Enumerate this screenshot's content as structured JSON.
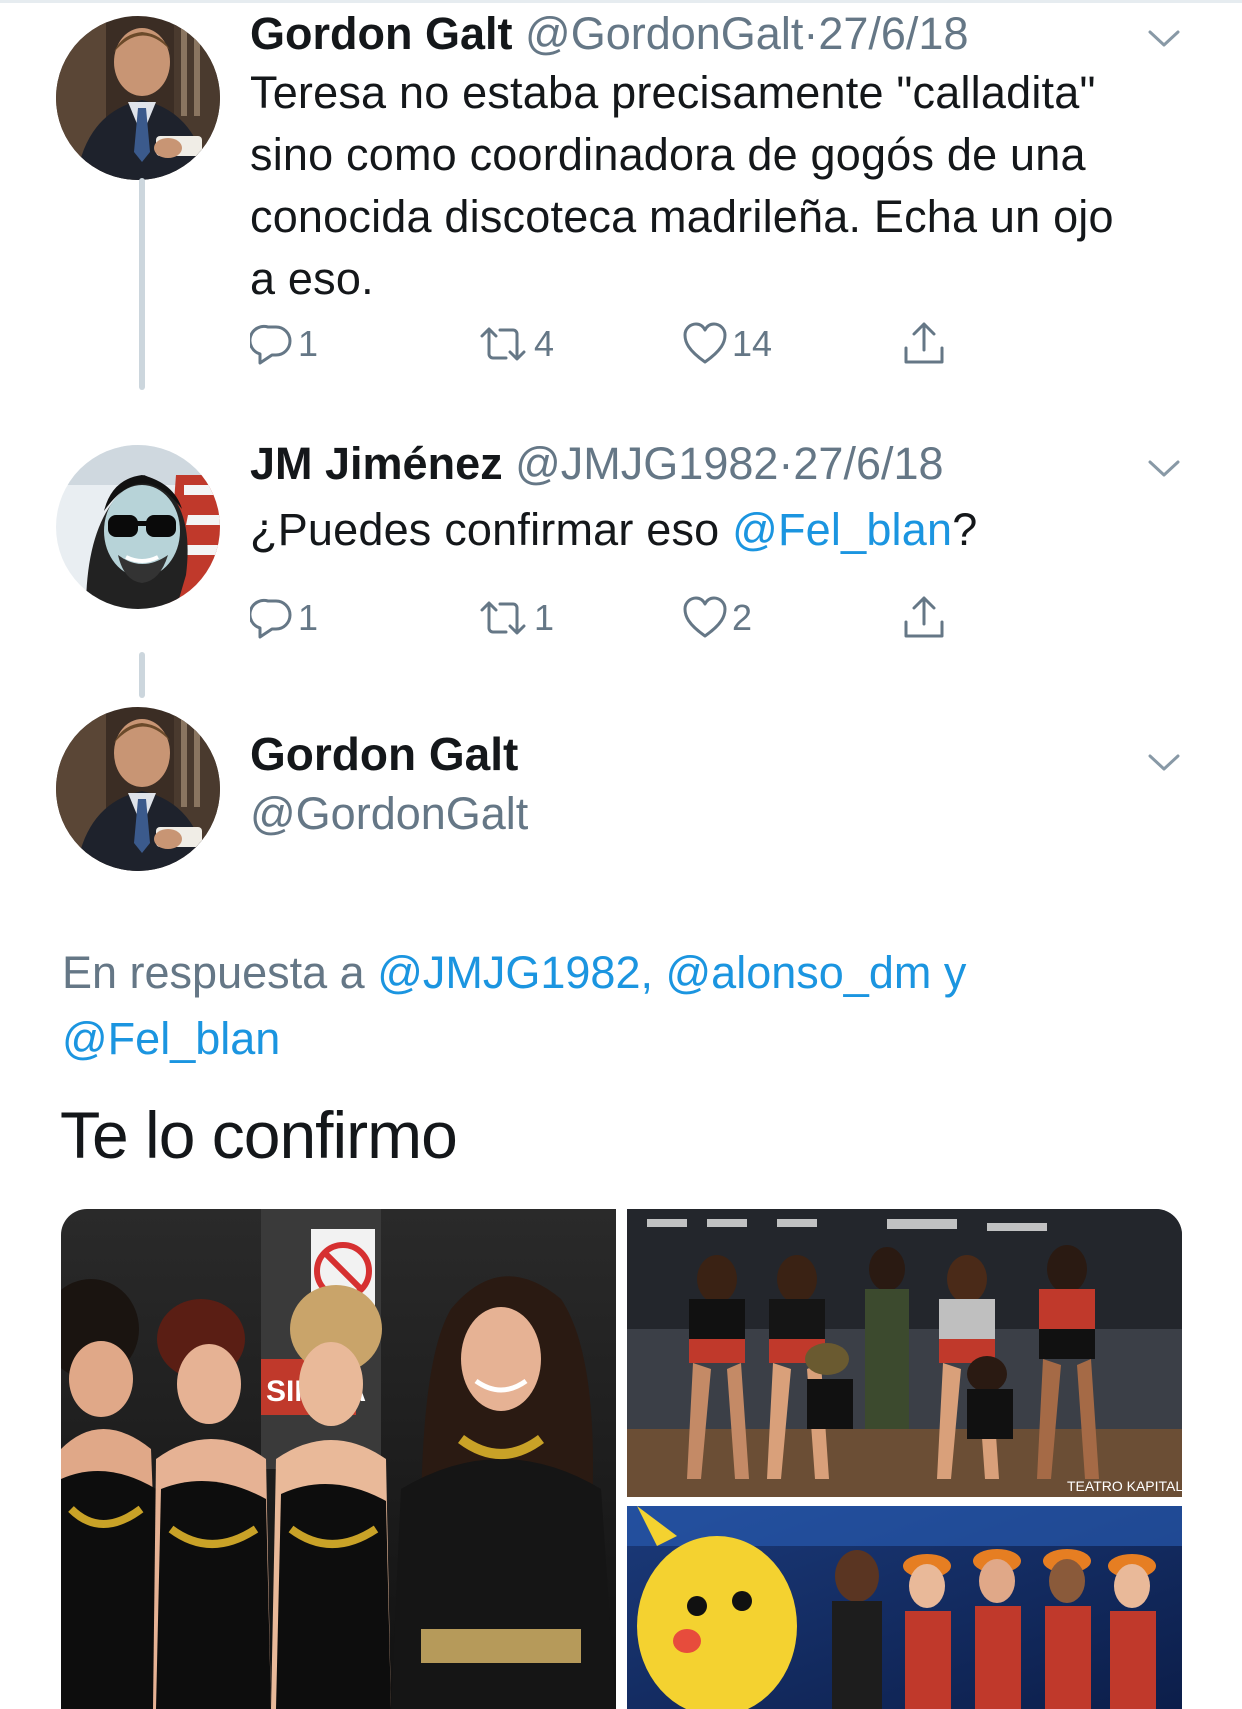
{
  "tweets": [
    {
      "name": "Gordon Galt",
      "handle": "@GordonGalt",
      "separator": "·",
      "date": "27/6/18",
      "text": "Teresa no estaba precisamente \"calladita\" sino como coordinadora de gogós de una conocida discoteca madrileña. Echa un ojo a eso.",
      "actions": {
        "replies": "1",
        "retweets": "4",
        "likes": "14"
      }
    },
    {
      "name": "JM Jiménez",
      "handle": "@JMJG1982",
      "separator": "·",
      "date": "27/6/18",
      "text_before": "¿Puedes confirmar eso ",
      "mention": "@Fel_blan",
      "text_after": "?",
      "actions": {
        "replies": "1",
        "retweets": "1",
        "likes": "2"
      }
    }
  ],
  "main_tweet": {
    "name": "Gordon Galt",
    "handle": "@GordonGalt",
    "reply_prefix": "En respuesta a ",
    "reply_mention_1": "@JMJG1982",
    "reply_comma": ", ",
    "reply_mention_2": "@alonso_dm",
    "reply_and": " y",
    "reply_mention_3": "@Fel_blan",
    "text": "Te lo confirmo"
  },
  "media_signs": {
    "sin_salida": "SIN SA",
    "teatro_kapital": "TEATRO KAPITAL"
  },
  "colors": {
    "link": "#1b95e0",
    "secondary_text": "#657786",
    "thread_line": "#ccd6dd"
  }
}
